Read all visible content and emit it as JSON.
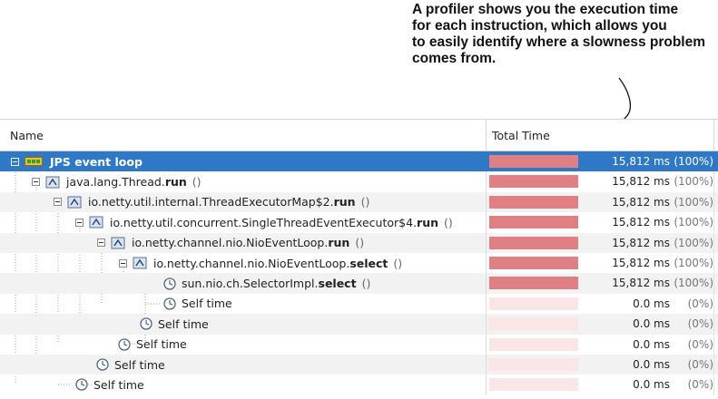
{
  "annotation": {
    "lines": [
      "A profiler shows you the execution time",
      "for each instruction, which allows you",
      "to easily identify where a slowness problem",
      "comes from."
    ]
  },
  "table": {
    "headers": {
      "name": "Name",
      "total_time": "Total Time"
    },
    "rows": [
      {
        "prefix": "JPS event loop",
        "method": "",
        "params": "",
        "time": "15,812 ms",
        "pct": "(100%)",
        "fill": 1.0
      },
      {
        "prefix": "java.lang.Thread.",
        "method": "run",
        "params": "()",
        "time": "15,812 ms",
        "pct": "(100%)",
        "fill": 1.0
      },
      {
        "prefix": "io.netty.util.internal.ThreadExecutorMap$2.",
        "method": "run",
        "params": "()",
        "time": "15,812 ms",
        "pct": "(100%)",
        "fill": 1.0
      },
      {
        "prefix": "io.netty.util.concurrent.SingleThreadEventExecutor$4.",
        "method": "run",
        "params": "()",
        "time": "15,812 ms",
        "pct": "(100%)",
        "fill": 1.0
      },
      {
        "prefix": "io.netty.channel.nio.NioEventLoop.",
        "method": "run",
        "params": "()",
        "time": "15,812 ms",
        "pct": "(100%)",
        "fill": 1.0
      },
      {
        "prefix": "io.netty.channel.nio.NioEventLoop.",
        "method": "select",
        "params": "()",
        "time": "15,812 ms",
        "pct": "(100%)",
        "fill": 1.0
      },
      {
        "prefix": "sun.nio.ch.SelectorImpl.",
        "method": "select",
        "params": "()",
        "time": "15,812 ms",
        "pct": "(100%)",
        "fill": 1.0
      },
      {
        "prefix": "Self time",
        "method": "",
        "params": "",
        "time": "0.0 ms",
        "pct": "(0%)",
        "fill": 0.0
      },
      {
        "prefix": "Self time",
        "method": "",
        "params": "",
        "time": "0.0 ms",
        "pct": "(0%)",
        "fill": 0.0
      },
      {
        "prefix": "Self time",
        "method": "",
        "params": "",
        "time": "0.0 ms",
        "pct": "(0%)",
        "fill": 0.0
      },
      {
        "prefix": "Self time",
        "method": "",
        "params": "",
        "time": "0.0 ms",
        "pct": "(0%)",
        "fill": 0.0
      },
      {
        "prefix": "Self time",
        "method": "",
        "params": "",
        "time": "0.0 ms",
        "pct": "(0%)",
        "fill": 0.0
      }
    ]
  },
  "icons": {
    "thread": "thread-icon",
    "method": "method-icon",
    "self_time": "clock-icon",
    "expanded": "collapse-toggle-icon"
  },
  "colors": {
    "selection": "#2e78c5",
    "bar": "#e07f84",
    "bar_empty": "#fbe6e7"
  }
}
